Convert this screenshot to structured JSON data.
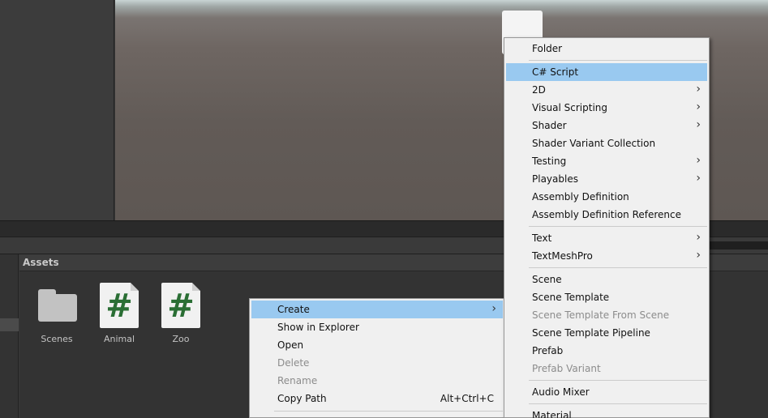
{
  "assets_panel": {
    "title": "Assets",
    "items": [
      {
        "name": "Scenes",
        "icon": "folder-icon"
      },
      {
        "name": "Animal",
        "icon": "csharp-script-icon"
      },
      {
        "name": "Zoo",
        "icon": "csharp-script-icon"
      }
    ],
    "script_glyph": "#"
  },
  "context_menu": {
    "items": [
      {
        "label": "Create",
        "submenu": true,
        "highlighted": true
      },
      {
        "label": "Show in Explorer"
      },
      {
        "label": "Open"
      },
      {
        "label": "Delete",
        "disabled": true
      },
      {
        "label": "Rename",
        "disabled": true
      },
      {
        "label": "Copy Path",
        "shortcut": "Alt+Ctrl+C"
      }
    ]
  },
  "create_submenu": {
    "items": [
      {
        "label": "Folder"
      },
      {
        "label": "C# Script",
        "highlighted": true
      },
      {
        "label": "2D",
        "submenu": true
      },
      {
        "label": "Visual Scripting",
        "submenu": true
      },
      {
        "label": "Shader",
        "submenu": true
      },
      {
        "label": "Shader Variant Collection"
      },
      {
        "label": "Testing",
        "submenu": true
      },
      {
        "label": "Playables",
        "submenu": true
      },
      {
        "label": "Assembly Definition"
      },
      {
        "label": "Assembly Definition Reference"
      },
      {
        "label": "Text",
        "submenu": true
      },
      {
        "label": "TextMeshPro",
        "submenu": true
      },
      {
        "label": "Scene"
      },
      {
        "label": "Scene Template"
      },
      {
        "label": "Scene Template From Scene",
        "disabled": true
      },
      {
        "label": "Scene Template Pipeline"
      },
      {
        "label": "Prefab"
      },
      {
        "label": "Prefab Variant",
        "disabled": true
      },
      {
        "label": "Audio Mixer"
      },
      {
        "label": "Material"
      }
    ],
    "arrow_glyph": "›"
  },
  "colors": {
    "menu_highlight": "#99c9f0",
    "menu_background": "#f0f0f0",
    "script_hash": "#2a6e34"
  }
}
